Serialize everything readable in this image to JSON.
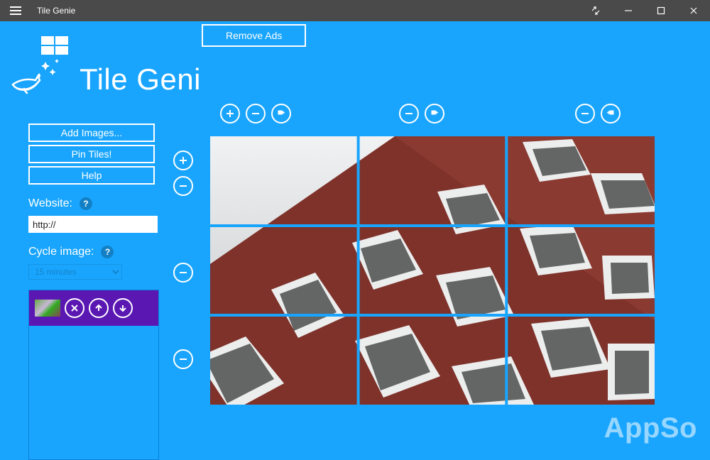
{
  "window": {
    "title": "Tile Genie"
  },
  "header": {
    "app_title": "Tile Genie",
    "remove_ads": "Remove Ads"
  },
  "sidebar": {
    "add_images": "Add Images...",
    "pin_tiles": "Pin Tiles!",
    "help": "Help",
    "website_label": "Website:",
    "website_value": "http://",
    "cycle_label": "Cycle image:",
    "cycle_value": "15 minutes"
  },
  "image_list": {
    "item_count": 1
  },
  "grid": {
    "rows": 3,
    "cols": 3
  },
  "watermark": "AppSo",
  "colors": {
    "accent": "#19a5fe",
    "titlebar": "#4a4a4a",
    "purple": "#5b17b2",
    "border_blue": "#0a7fd6"
  }
}
